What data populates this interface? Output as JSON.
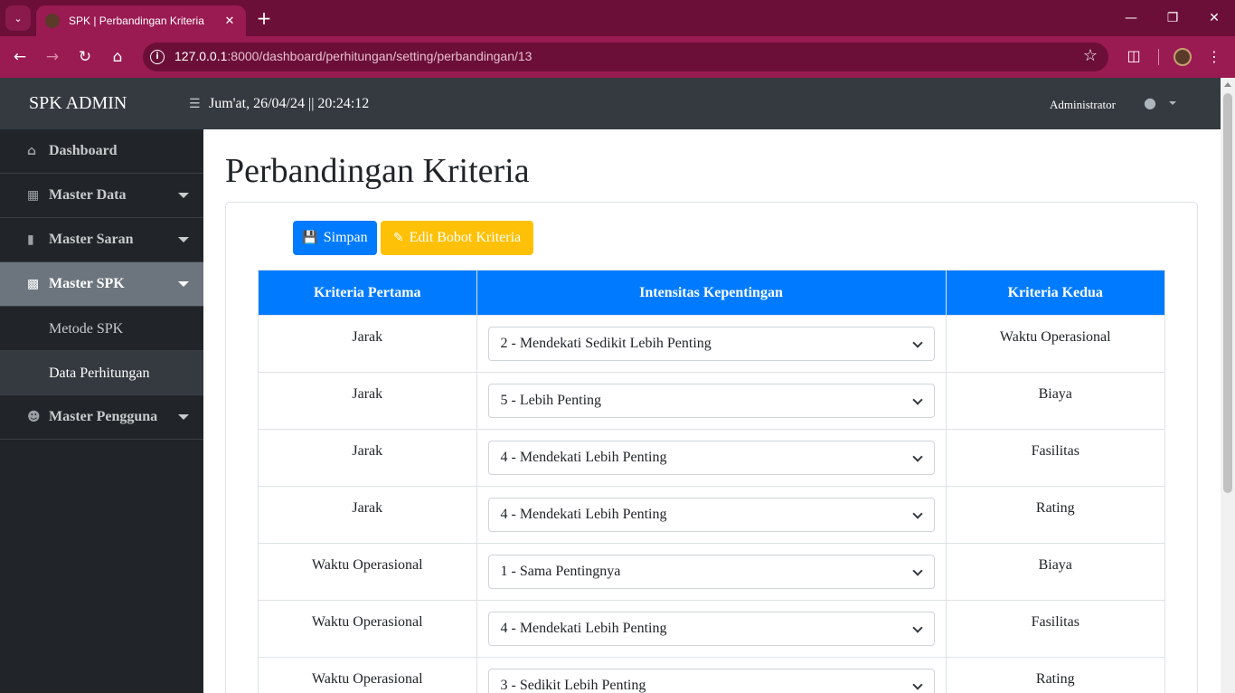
{
  "browser": {
    "tab_title": "SPK | Perbandingan Kriteria",
    "url_host": "127.0.0.1",
    "url_rest": ":8000/dashboard/perhitungan/setting/perbandingan/13"
  },
  "app": {
    "brand": "SPK ADMIN",
    "datetime": "Jum'at, 26/04/24 || 20:24:12",
    "user": "Administrator"
  },
  "sidebar": {
    "items": [
      {
        "label": "Dashboard",
        "icon": "home-icon"
      },
      {
        "label": "Master Data",
        "icon": "cubes-icon"
      },
      {
        "label": "Master Saran",
        "icon": "comment-icon"
      },
      {
        "label": "Master SPK",
        "icon": "sitemap-icon"
      },
      {
        "label": "Metode SPK"
      },
      {
        "label": "Data Perhitungan"
      },
      {
        "label": "Master Pengguna",
        "icon": "user-cog-icon"
      }
    ]
  },
  "page": {
    "title": "Perbandingan Kriteria",
    "save_label": "Simpan",
    "edit_label": "Edit Bobot Kriteria"
  },
  "table": {
    "headers": [
      "Kriteria Pertama",
      "Intensitas Kepentingan",
      "Kriteria Kedua"
    ],
    "rows": [
      {
        "first": "Jarak",
        "intensity": "2 - Mendekati Sedikit Lebih Penting",
        "second": "Waktu Operasional"
      },
      {
        "first": "Jarak",
        "intensity": "5 - Lebih Penting",
        "second": "Biaya"
      },
      {
        "first": "Jarak",
        "intensity": "4 - Mendekati Lebih Penting",
        "second": "Fasilitas"
      },
      {
        "first": "Jarak",
        "intensity": "4 - Mendekati Lebih Penting",
        "second": "Rating"
      },
      {
        "first": "Waktu Operasional",
        "intensity": "1 - Sama Pentingnya",
        "second": "Biaya"
      },
      {
        "first": "Waktu Operasional",
        "intensity": "4 - Mendekati Lebih Penting",
        "second": "Fasilitas"
      },
      {
        "first": "Waktu Operasional",
        "intensity": "3 - Sedikit Lebih Penting",
        "second": "Rating"
      }
    ]
  },
  "colors": {
    "primary": "#007bff",
    "warning": "#ffc107",
    "sidebar_bg": "#212529",
    "browser_tab": "#9a1a52"
  }
}
